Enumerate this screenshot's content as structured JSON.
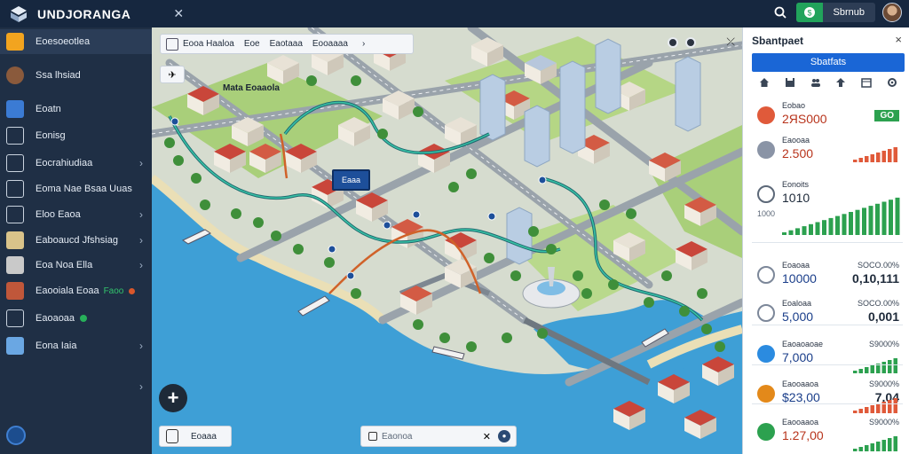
{
  "app": {
    "title": "UNDJORANGA",
    "money_label": "Sbrnub"
  },
  "sidebar": {
    "items": [
      {
        "label": "Eoesoeotlea",
        "icon": "folder-icon",
        "color": "#f2a41f",
        "chevron": false
      },
      {
        "label": "Ssa lhsiad",
        "icon": "user-avatar-icon",
        "color": "#8a5a3c",
        "chevron": false
      },
      {
        "label": "Eoatn",
        "icon": "building-blue-icon",
        "color": "#3b7bd4",
        "chevron": false
      },
      {
        "label": "Eonisg",
        "icon": "house-outline-icon",
        "color": "#c9d3df",
        "chevron": false
      },
      {
        "label": "Eocrahiudiaa",
        "icon": "list-icon",
        "color": "#c9d3df",
        "chevron": true
      },
      {
        "label": "Eoma Nae Bsaa Uuas",
        "icon": "road-icon",
        "color": "#c9d3df",
        "chevron": false
      },
      {
        "label": "Eloo Eaoa",
        "icon": "chart-icon",
        "color": "#c9d3df",
        "chevron": true
      },
      {
        "label": "Eaboaucd Jfshsiag",
        "icon": "factory-icon",
        "color": "#d9c38a",
        "chevron": true
      },
      {
        "label": "Eoa Noa Ella",
        "icon": "bank-icon",
        "color": "#c9c9c9",
        "chevron": true
      },
      {
        "label": "Eaooiala Eoaa",
        "badge": "Faoo",
        "icon": "store-icon",
        "color": "#c0573a",
        "chevron": false
      },
      {
        "label": "Eaoaoaa",
        "icon": "park-icon",
        "color": "#c9d3df",
        "chevron": false
      },
      {
        "label": "Eona Iaia",
        "icon": "water-tower-icon",
        "color": "#6aa7e3",
        "chevron": true
      }
    ]
  },
  "map": {
    "toolbar_tabs": [
      "Eooa Haaloa",
      "Eoe",
      "Eaotaaa",
      "Eooaaaa"
    ],
    "district_label": "Mata Eoaaola",
    "route_sign": "Eaaa",
    "bottom_left_label": "Eoaaa",
    "search_placeholder": "Eaonoa"
  },
  "panel": {
    "title": "Sbantpaet",
    "close": "×",
    "button": "Sbatfats",
    "icon_row": [
      "home-icon",
      "save-icon",
      "people-icon",
      "upload-icon",
      "calendar-icon",
      "settings-icon"
    ],
    "stats": [
      {
        "label": "Eobao",
        "value": "2ЯS000",
        "side_value": "GO",
        "icon": "coin-icon",
        "icon_color": "#e05a3a"
      },
      {
        "label": "Eaooaa",
        "value": "2.500",
        "side_value": "",
        "icon": "power-icon",
        "icon_color": "#8a94a6"
      },
      {
        "label": "Eonoits",
        "value": "1010",
        "side_value": "",
        "icon": "diamond-icon",
        "icon_color": "#5c6878"
      },
      {
        "label": "Eoaoaa",
        "value": "10000",
        "side_value": "0,10,111",
        "side_label": "SOCO.00%",
        "icon": "gem-icon",
        "icon_color": "#7c8799"
      },
      {
        "label": "Eoaloaa",
        "value": "5,000",
        "side_value": "0,001",
        "side_label": "SOCO.00%",
        "icon": "gear-icon",
        "icon_color": "#7c8799"
      },
      {
        "label": "Eaoaoaoae",
        "value": "7,000",
        "side_value": "",
        "side_label": "S9000%",
        "icon": "water-icon",
        "icon_color": "#2b8be0"
      },
      {
        "label": "Eaooaaoa",
        "value": "$23,00",
        "side_value": "7,04",
        "side_label": "S9000%",
        "icon": "pie-icon",
        "icon_color": "#e3891a"
      },
      {
        "label": "Eaooaaoa",
        "value": "1.27,00",
        "side_value": "",
        "side_label": "S9000%",
        "icon": "leaf-icon",
        "icon_color": "#2ca14f"
      }
    ],
    "chart_axis_label": "1000"
  },
  "colors": {
    "topbar": "#16273f",
    "sidebar": "#1f2f45",
    "accent_blue": "#1a66d6",
    "positive_green": "#2ca14f",
    "negative_red": "#e05a3a",
    "water": "#3e9fd6"
  }
}
